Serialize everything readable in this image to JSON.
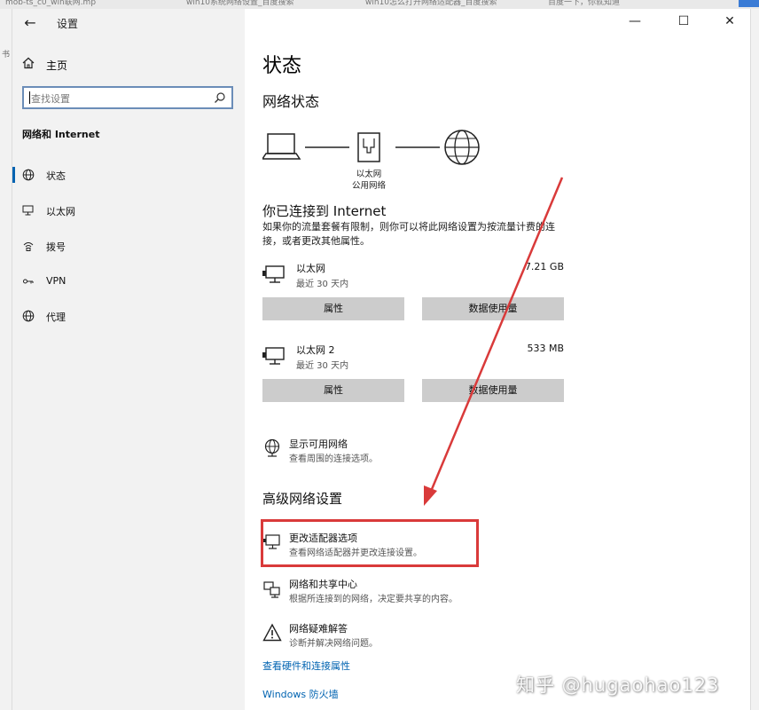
{
  "background": {
    "tabs": [
      "mob-ts_c0_win联网.mp",
      "win10系统网络设置_百度搜索",
      "win10怎么打开网络适配器_百度搜索",
      "百度一下，你就知道"
    ],
    "left_glyph": "书"
  },
  "window": {
    "title": "设置",
    "controls": {
      "minimize": "—",
      "maximize": "☐",
      "close": "✕"
    }
  },
  "sidebar": {
    "home_label": "主页",
    "search_placeholder": "查找设置",
    "section_heading": "网络和 Internet",
    "items": [
      {
        "label": "状态",
        "icon": "globe-icon",
        "active": true
      },
      {
        "label": "以太网",
        "icon": "ethernet-icon",
        "active": false
      },
      {
        "label": "拨号",
        "icon": "dialup-icon",
        "active": false
      },
      {
        "label": "VPN",
        "icon": "vpn-icon",
        "active": false
      },
      {
        "label": "代理",
        "icon": "proxy-globe-icon",
        "active": false
      }
    ]
  },
  "content": {
    "page_title": "状态",
    "network_status_heading": "网络状态",
    "diagram": {
      "adapter_label": "以太网",
      "network_type": "公用网络"
    },
    "connected_heading": "你已连接到 Internet",
    "metered_note": "如果你的流量套餐有限制，则你可以将此网络设置为按流量计费的连接，或者更改其他属性。",
    "adapters": [
      {
        "name": "以太网",
        "period": "最近 30 天内",
        "usage": "7.21 GB",
        "properties_label": "属性",
        "data_usage_label": "数据使用量"
      },
      {
        "name": "以太网 2",
        "period": "最近 30 天内",
        "usage": "533 MB",
        "properties_label": "属性",
        "data_usage_label": "数据使用量"
      }
    ],
    "show_networks": {
      "title": "显示可用网络",
      "subtitle": "查看周围的连接选项。"
    },
    "advanced_heading": "高级网络设置",
    "advanced_items": [
      {
        "title": "更改适配器选项",
        "subtitle": "查看网络适配器并更改连接设置。",
        "icon": "adapter-monitor-icon"
      },
      {
        "title": "网络和共享中心",
        "subtitle": "根据所连接到的网络，决定要共享的内容。",
        "icon": "sharing-center-icon"
      },
      {
        "title": "网络疑难解答",
        "subtitle": "诊断并解决网络问题。",
        "icon": "warning-triangle-icon"
      }
    ],
    "links": [
      "查看硬件和连接属性",
      "Windows 防火墙"
    ]
  },
  "annotation": {
    "color": "#d93a3a"
  },
  "watermark": "知乎 @hugaohao123",
  "colors": {
    "accent": "#0063b1",
    "sidebar_bg": "#f2f2f2",
    "button_bg": "#cccccc"
  }
}
